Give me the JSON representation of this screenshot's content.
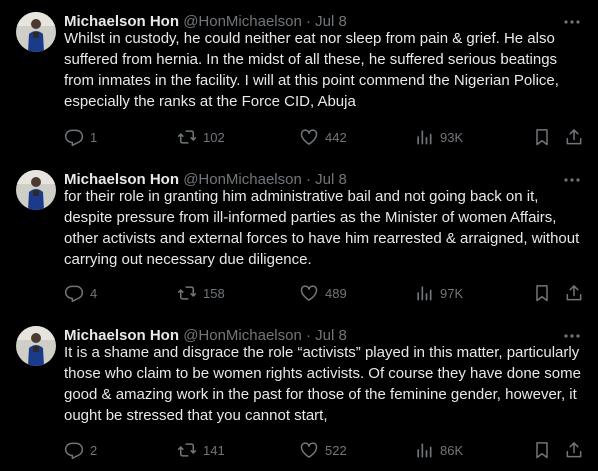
{
  "tweets": [
    {
      "name": "Michaelson Hon",
      "handle": "@HonMichaelson",
      "separator": "·",
      "date": "Jul 8",
      "text": "Whilst in custody, he could neither eat nor sleep from pain & grief. He also suffered from hernia. In the midst of all these, he suffered serious beatings from inmates in the facility. I will at this point commend the Nigerian Police, especially the ranks at the Force CID, Abuja",
      "replies": "1",
      "reposts": "102",
      "likes": "442",
      "views": "93K"
    },
    {
      "name": "Michaelson Hon",
      "handle": "@HonMichaelson",
      "separator": "·",
      "date": "Jul 8",
      "text": "for their role in granting him administrative bail and not going back on it, despite pressure from ill-informed parties as the Minister of women Affairs, other activists and external forces to have him rearrested & arraigned, without carrying out necessary due diligence.",
      "replies": "4",
      "reposts": "158",
      "likes": "489",
      "views": "97K"
    },
    {
      "name": "Michaelson Hon",
      "handle": "@HonMichaelson",
      "separator": "·",
      "date": "Jul 8",
      "text": "It is a shame and disgrace the role “activists” played in this matter, particularly those who claim to be women rights activists. Of course they have done some good & amazing work in the past for those of the feminine gender, however, it ought be stressed that you cannot start,",
      "replies": "2",
      "reposts": "141",
      "likes": "522",
      "views": "86K"
    }
  ],
  "icons": {
    "more": "more-dots-icon",
    "reply": "reply-icon",
    "repost": "repost-icon",
    "like": "heart-icon",
    "views": "views-icon",
    "bookmark": "bookmark-icon",
    "share": "share-icon"
  },
  "colors": {
    "background": "#000000",
    "text": "#e7e9ea",
    "secondary": "#71767b"
  }
}
